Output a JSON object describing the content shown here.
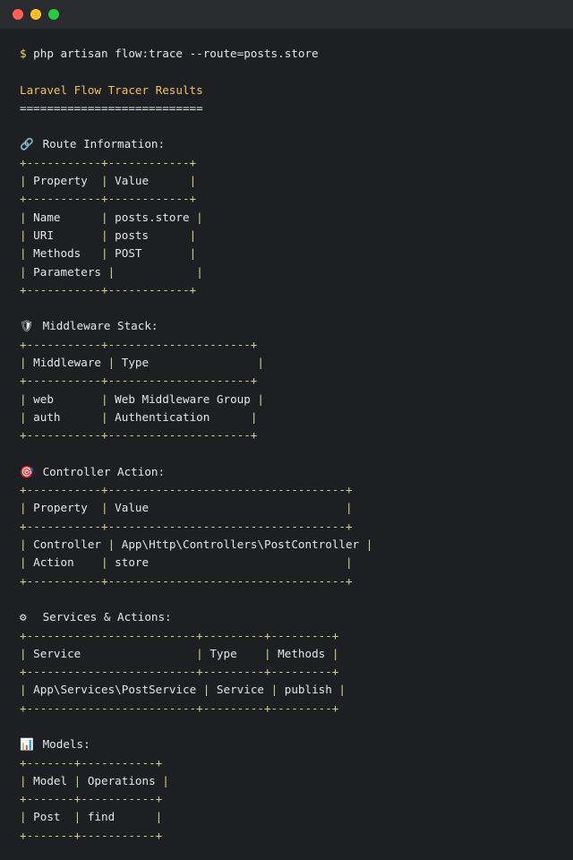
{
  "window": {
    "buttons": [
      {
        "name": "close",
        "color": "#ff5f57"
      },
      {
        "name": "minimize",
        "color": "#febc2e"
      },
      {
        "name": "maximize",
        "color": "#28c840"
      }
    ]
  },
  "command": {
    "prompt": "$",
    "text": " php artisan flow:trace --route=posts.store"
  },
  "results": {
    "title": "Laravel Flow Tracer Results",
    "underline": "==========================="
  },
  "sections": [
    {
      "id": "route",
      "icon": "🔗",
      "icon_name": "link-icon",
      "title": "Route Information:",
      "table": [
        "+-----------+------------+",
        "| Property  | Value      |",
        "+-----------+------------+",
        "| Name      | posts.store |",
        "| URI       | posts      |",
        "| Methods   | POST       |",
        "| Parameters |            |",
        "+-----------+------------+"
      ]
    },
    {
      "id": "middleware",
      "icon": "🛡",
      "icon_name": "shield-icon",
      "title": "Middleware Stack:",
      "table": [
        "+-----------+---------------------+",
        "| Middleware | Type                |",
        "+-----------+---------------------+",
        "| web       | Web Middleware Group |",
        "| auth      | Authentication      |",
        "+-----------+---------------------+"
      ]
    },
    {
      "id": "controller",
      "icon": "🎯",
      "icon_name": "target-icon",
      "title": "Controller Action:",
      "table": [
        "+-----------+-----------------------------------+",
        "| Property  | Value                             |",
        "+-----------+-----------------------------------+",
        "| Controller | App\\Http\\Controllers\\PostController |",
        "| Action    | store                             |",
        "+-----------+-----------------------------------+"
      ]
    },
    {
      "id": "services",
      "icon": "⚙",
      "icon_name": "gear-icon",
      "title": "Services & Actions:",
      "table": [
        "+-------------------------+---------+---------+",
        "| Service                 | Type    | Methods |",
        "+-------------------------+---------+---------+",
        "| App\\Services\\PostService | Service | publish |",
        "+-------------------------+---------+---------+"
      ]
    },
    {
      "id": "models",
      "icon": "📊",
      "icon_name": "bar-chart-icon",
      "title": "Models:",
      "table": [
        "+-------+-----------+",
        "| Model | Operations |",
        "+-------+-----------+",
        "| Post  | find      |",
        "+-------+-----------+"
      ]
    }
  ]
}
